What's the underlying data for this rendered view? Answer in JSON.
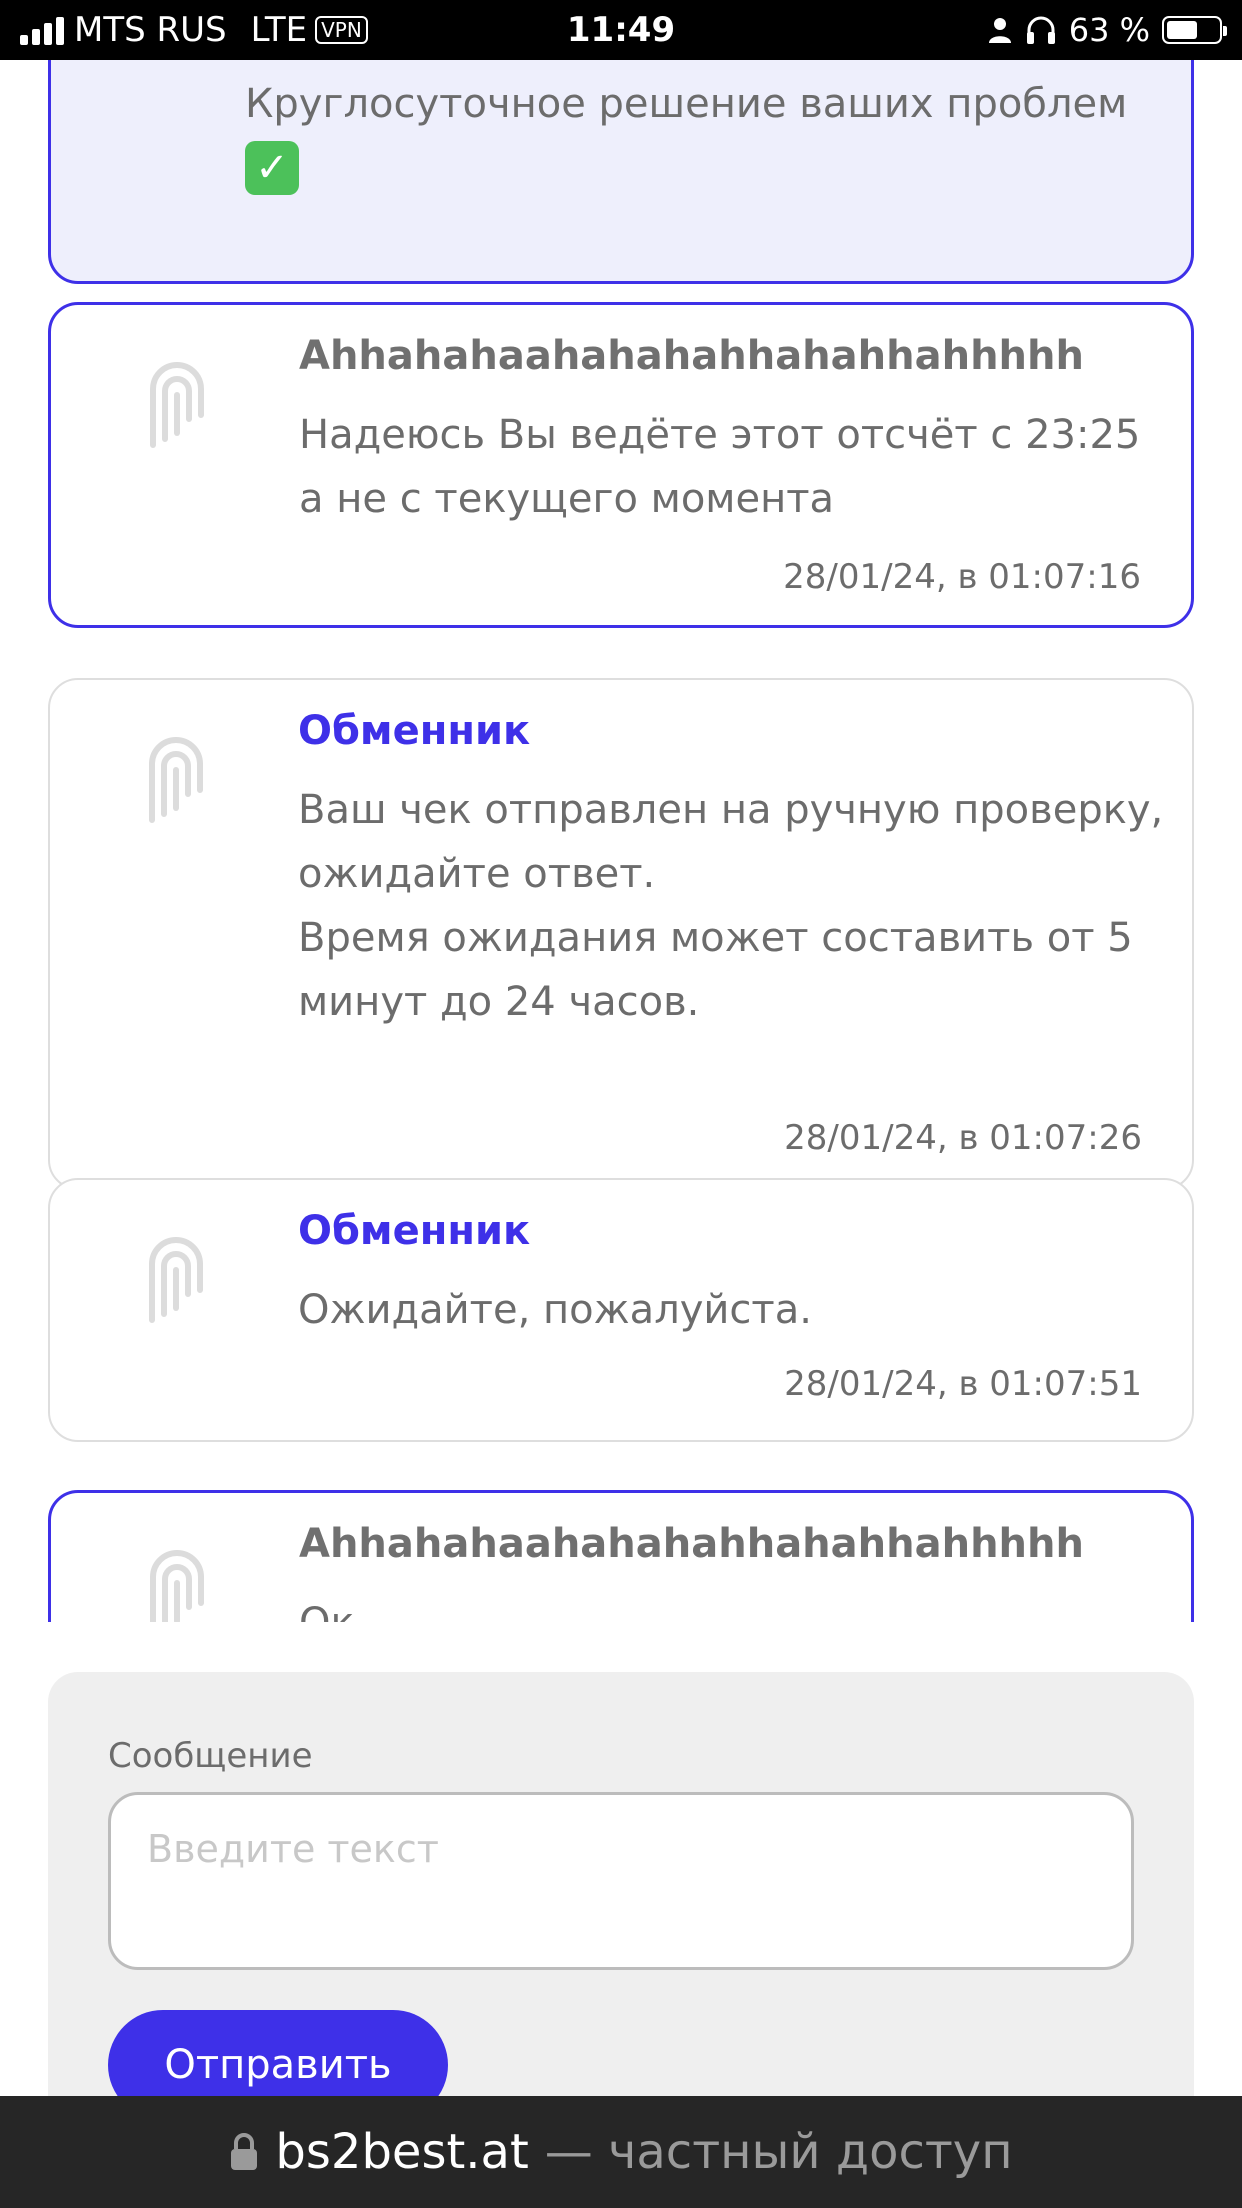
{
  "status_bar": {
    "carrier": "MTS RUS",
    "network": "LTE",
    "vpn": "VPN",
    "time": "11:49",
    "battery_text": "63 %",
    "battery_level": 0.63
  },
  "top_card": {
    "text": "Круглосуточное решение ваших проблем",
    "emoji_icon": "check-mark-button"
  },
  "messages": [
    {
      "author": "Ahhahahaahahahahhahahhahhhhh",
      "own": true,
      "text": "Надеюсь Вы ведёте этот отсчёт с 23:25\nа не с текущего момента",
      "time": "28/01/24, в 01:07:16"
    },
    {
      "author": "Обменник",
      "own": false,
      "text": "Ваш чек отправлен на ручную проверку, ожидайте ответ.\nВремя ожидания может составить от 5 минут до 24 часов.",
      "time": "28/01/24, в 01:07:26"
    },
    {
      "author": "Обменник",
      "own": false,
      "text": "Ожидайте, пожалуйста.",
      "time": "28/01/24, в 01:07:51"
    },
    {
      "author": "Ahhahahaahahahahhahahhahhhhh",
      "own": true,
      "text": "Ок",
      "time": ""
    }
  ],
  "composer": {
    "label": "Сообщение",
    "placeholder": "Введите текст",
    "value": "",
    "send_label": "Отправить"
  },
  "url_bar": {
    "domain": "bs2best.at",
    "suffix": "— частный доступ",
    "icon": "lock-icon"
  },
  "colors": {
    "accent": "#3e30e8",
    "card_highlight_bg": "#eeeffc",
    "text_gray": "#6c6c6c"
  }
}
